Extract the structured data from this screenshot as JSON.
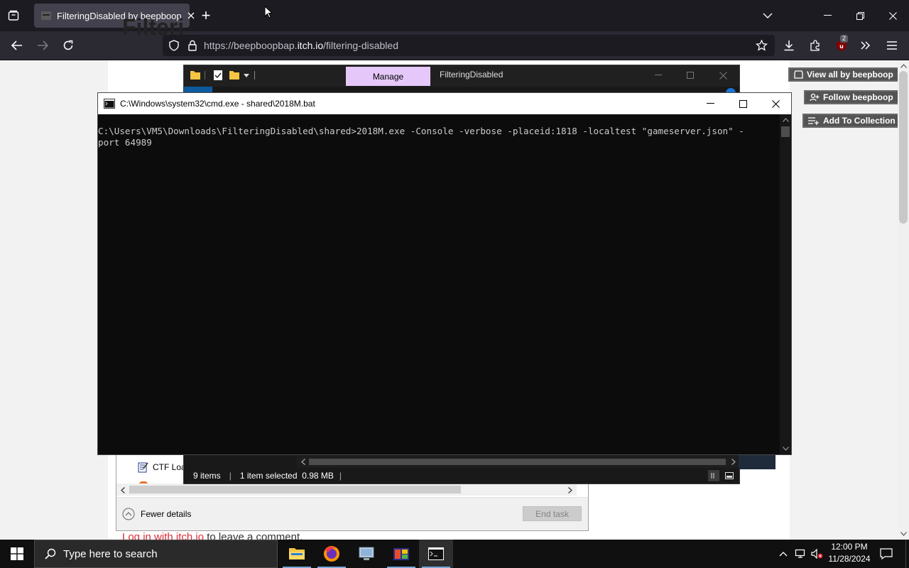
{
  "browser": {
    "tab_title": "FilteringDisabled by beepboop",
    "new_tab": "+",
    "url_prefix": "https://beepboopbap.",
    "url_domain": "itch.io",
    "url_path": "/filtering-disabled",
    "extension_badge": "2"
  },
  "page": {
    "title_partial": "Filteri",
    "buttons": [
      "View all by beepboop",
      "Follow beepboop",
      "Add To Collection"
    ],
    "comment_link": "Log in with itch.io",
    "comment_rest": " to leave a comment."
  },
  "task_manager": {
    "row_label": "CTF Loa",
    "fewer_details": "Fewer details",
    "end_task": "End task"
  },
  "explorer": {
    "tab_manage": "Manage",
    "title": "FilteringDisabled",
    "status_items": "9 items",
    "status_selected": "1 item selected  0.98 MB"
  },
  "cmd": {
    "title": "C:\\Windows\\system32\\cmd.exe - shared\\2018M.bat",
    "line1": "C:\\Users\\VM5\\Downloads\\FilteringDisabled\\shared>2018M.exe -Console -verbose -placeid:1818 -localtest \"gameserver.json\" -",
    "line2": "port 64989"
  },
  "taskbar": {
    "search_placeholder": "Type here to search",
    "time": "12:00 PM",
    "date": "11/28/2024"
  }
}
